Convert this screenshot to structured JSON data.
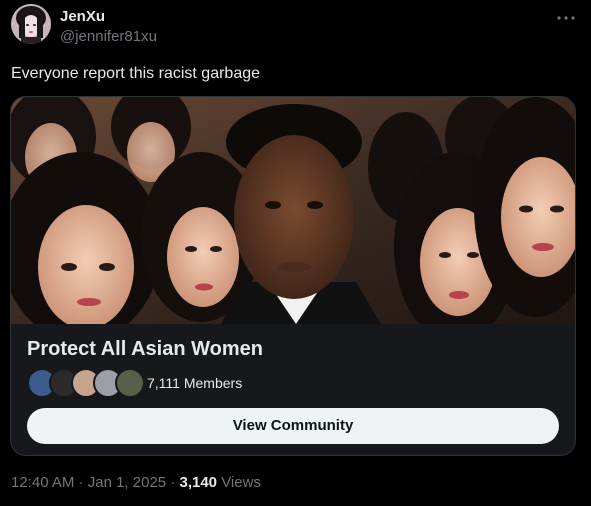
{
  "post": {
    "display_name": "JenXu",
    "handle": "@jennifer81xu",
    "more_icon": "more-horizontal-icon",
    "text": "Everyone report this racist garbage"
  },
  "community_card": {
    "name": "Protect All Asian Women",
    "member_count_text": "7,111 Members",
    "button_label": "View Community",
    "member_avatar_colors": [
      "#3b5b8c",
      "#2b2b2b",
      "#c9a48c",
      "#9aa0a6",
      "#5a5f4a"
    ]
  },
  "meta": {
    "time": "12:40 AM",
    "separator_1": "·",
    "date": "Jan 1, 2025",
    "separator_2": "·",
    "views_count": "3,140",
    "views_label": "Views"
  },
  "colors": {
    "background": "#000000",
    "text_primary": "#e7e9ea",
    "text_secondary": "#71767b",
    "border": "#2f3336",
    "button_bg": "#eff3f4"
  }
}
